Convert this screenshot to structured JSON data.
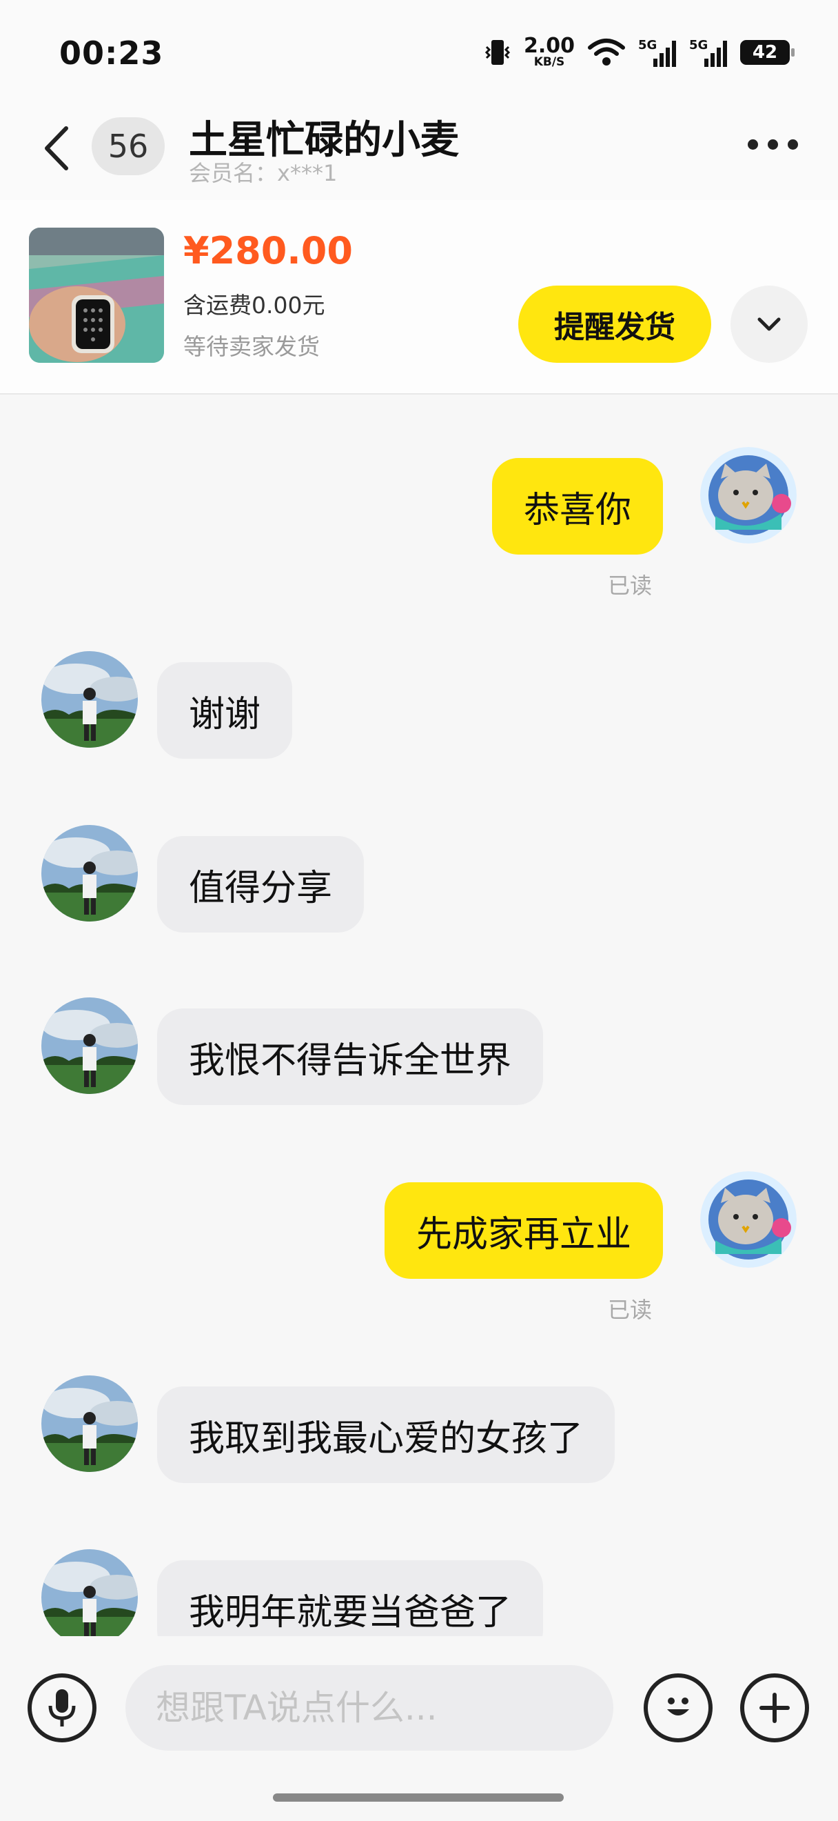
{
  "status": {
    "time": "00:23",
    "net_speed": "2.00",
    "net_unit": "KB/S",
    "sig1": "5G",
    "sig2": "5G",
    "battery": "42"
  },
  "header": {
    "unread_count": "56",
    "title": "土星忙碌的小麦",
    "member": "会员名：x***1"
  },
  "order": {
    "price": "¥280.00",
    "shipping": "含运费0.00元",
    "status": "等待卖家发货",
    "remind_label": "提醒发货"
  },
  "messages": [
    {
      "from": "me",
      "text": "恭喜你",
      "read": "已读"
    },
    {
      "from": "them",
      "text": "谢谢"
    },
    {
      "from": "them",
      "text": "值得分享"
    },
    {
      "from": "them",
      "text": "我恨不得告诉全世界"
    },
    {
      "from": "me",
      "text": "先成家再立业",
      "read": "已读"
    },
    {
      "from": "them",
      "text": "我取到我最心爱的女孩了"
    },
    {
      "from": "them",
      "text": "我明年就要当爸爸了"
    }
  ],
  "input": {
    "placeholder": "想跟TA说点什么..."
  },
  "colors": {
    "accent": "#ffe60f",
    "price": "#ff5a1f",
    "bubble_other": "#ececee"
  }
}
